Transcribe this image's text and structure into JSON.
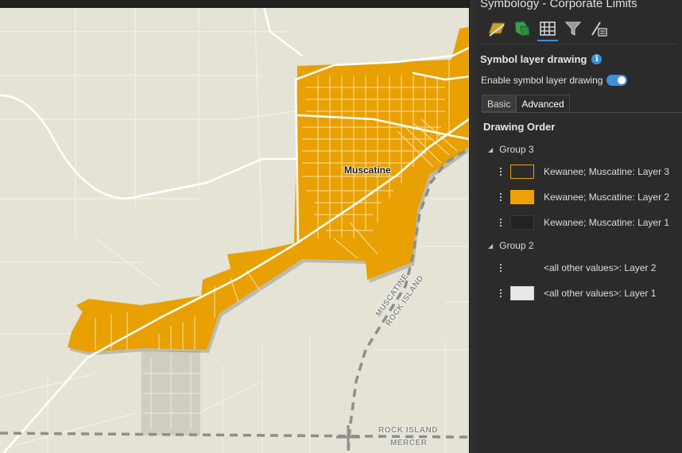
{
  "map": {
    "city_label": "Muscatine",
    "rail_labels": [
      "MUSCATINE",
      "ROCK ISLAND",
      "ROCK ISLAND",
      "MERCER"
    ],
    "colors": {
      "background": "#e4e3d6",
      "city_fill": "#e8a002",
      "roads": "#ffffff"
    }
  },
  "pane": {
    "title": "Symbology - Corporate Limits",
    "toolbar": [
      {
        "icon": "primary-symbology-icon"
      },
      {
        "icon": "vary-symbology-icon"
      },
      {
        "icon": "symbol-layer-drawing-icon",
        "active": true
      },
      {
        "icon": "filter-icon"
      },
      {
        "icon": "more-options-icon"
      }
    ],
    "section_title": "Symbol layer drawing",
    "toggle_label": "Enable symbol layer drawing",
    "toggle_on": true,
    "tabs": [
      "Basic",
      "Advanced"
    ],
    "active_tab": "Advanced",
    "order_title": "Drawing Order",
    "groups": [
      {
        "label": "Group 3",
        "layers": [
          {
            "label": "Kewanee; Muscatine: Layer 3",
            "swatch_fill": "#2b2b2b",
            "swatch_border": "#e8a002"
          },
          {
            "label": "Kewanee; Muscatine: Layer 2",
            "swatch_fill": "#f0a000",
            "swatch_border": "#f0a000"
          },
          {
            "label": "Kewanee; Muscatine: Layer 1",
            "swatch_fill": "#222222",
            "swatch_border": "#3a3a3a"
          }
        ]
      },
      {
        "label": "Group 2",
        "layers": [
          {
            "label": "<all other values>: Layer 2",
            "swatch_fill": "",
            "swatch_border": ""
          },
          {
            "label": "<all other values>: Layer 1",
            "swatch_fill": "#e8e8e8",
            "swatch_border": "#cccccc"
          }
        ]
      }
    ]
  }
}
